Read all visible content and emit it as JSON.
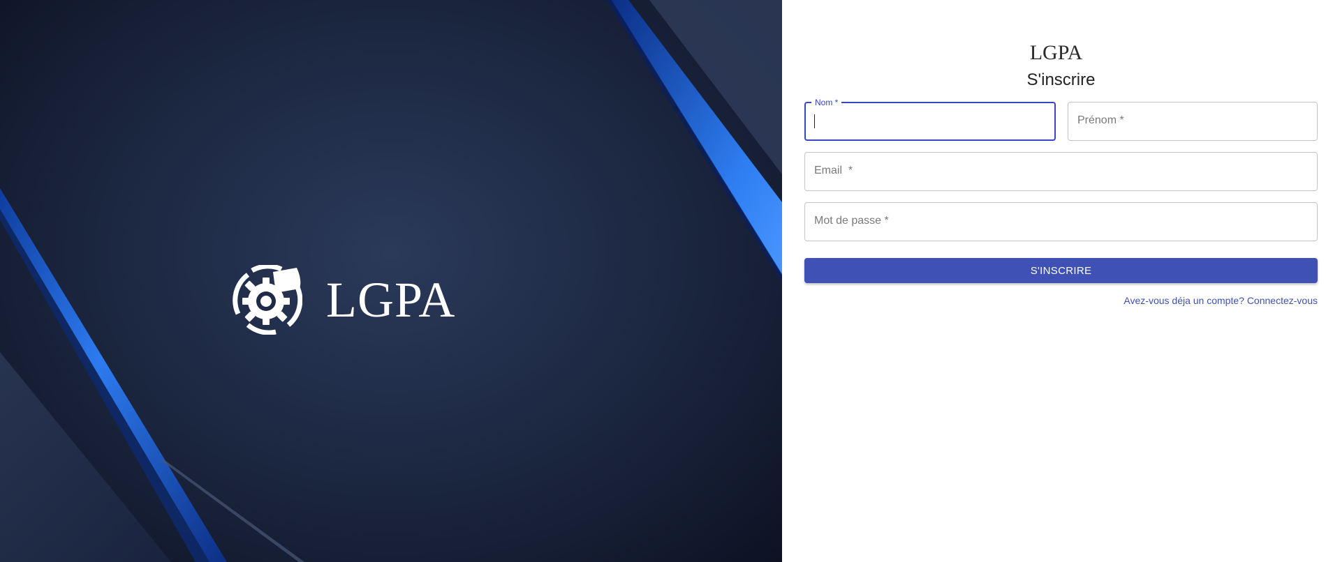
{
  "left": {
    "brand_name": "LGPA",
    "logo_icon": "gear-gauge-icon",
    "colors": {
      "background": "#1f2b46",
      "accent_blue": "#2a6fe0"
    }
  },
  "right": {
    "app_title": "LGPA",
    "form_title": "S'inscrire",
    "fields": {
      "nom": {
        "label": "Nom *",
        "value": ""
      },
      "prenom": {
        "placeholder": "Prénom *",
        "value": ""
      },
      "email": {
        "placeholder": "Email  *",
        "value": ""
      },
      "password": {
        "placeholder": "Mot de passe *",
        "value": ""
      }
    },
    "submit_label": "S'INSCRIRE",
    "signin_link": "Avez-vous déja un compte? Connectez-vous",
    "colors": {
      "primary": "#3f51b5",
      "focus": "#3446c0"
    }
  }
}
